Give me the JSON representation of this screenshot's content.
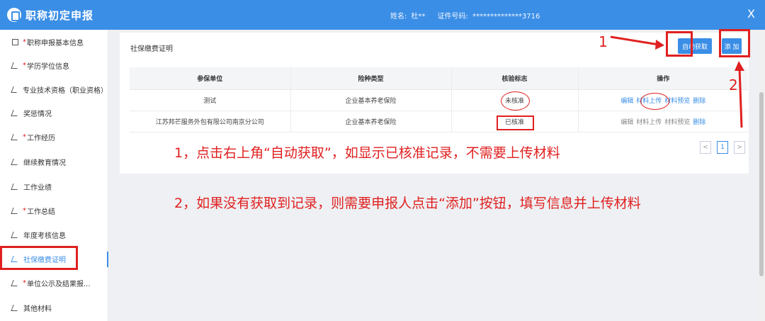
{
  "header": {
    "title": "职称初定申报",
    "name_label": "姓名:",
    "name_value": "杜**",
    "id_label": "证件号码:",
    "id_value": "**************3716",
    "close": "X"
  },
  "sidebar": {
    "items": [
      {
        "label": "职称申报基本信息",
        "required": "*"
      },
      {
        "label": "学历学位信息",
        "required": "*"
      },
      {
        "label": "专业技术资格（职业资格）",
        "required": ""
      },
      {
        "label": "奖惩情况",
        "required": ""
      },
      {
        "label": "工作经历",
        "required": "*"
      },
      {
        "label": "继续教育情况",
        "required": ""
      },
      {
        "label": "工作业绩",
        "required": ""
      },
      {
        "label": "工作总结",
        "required": "*"
      },
      {
        "label": "年度考核信息",
        "required": ""
      },
      {
        "label": "社保缴费证明",
        "required": ""
      },
      {
        "label": "单位公示及结果报...",
        "required": "*"
      },
      {
        "label": "其他材料",
        "required": ""
      }
    ]
  },
  "main": {
    "title": "社保缴费证明",
    "auto_button": "自动获取",
    "add_button": "添 加",
    "columns": [
      "参保单位",
      "险种类型",
      "核验标志",
      "操作"
    ],
    "rows": [
      {
        "unit": "测试",
        "type": "企业基本养老保险",
        "status": "未核准"
      },
      {
        "unit": "江苏邦芒服务外包有限公司南京分公司",
        "type": "企业基本养老保险",
        "status": "已核准"
      }
    ],
    "row1_ops": [
      "编辑",
      "材料上传",
      "材料预览",
      "删除"
    ],
    "row2_ops": [
      "编辑",
      "材料上传",
      "材料预览",
      "删除"
    ],
    "pager": {
      "prev": "<",
      "current": "1",
      "next": ">"
    }
  },
  "annotations": {
    "num1": "1",
    "num2": "2",
    "note1": "1，点击右上角“自动获取”，如显示已核准记录，不需要上传材料",
    "note2": "2，如果没有获取到记录，则需要申报人点击“添加”按钮，填写信息并上传材料"
  }
}
